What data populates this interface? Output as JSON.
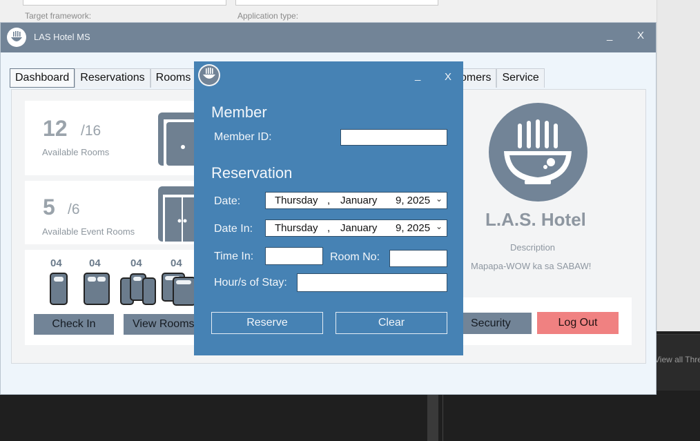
{
  "background": {
    "target_framework_label": "Target framework:",
    "application_type_label": "Application type:",
    "view_all_text": "View all Thre"
  },
  "window": {
    "title": "LAS Hotel MS",
    "minimize": "_",
    "close": "X"
  },
  "tabs": [
    "Dashboard",
    "Reservations",
    "Rooms",
    "omers",
    "Service"
  ],
  "dashboard": {
    "rooms": {
      "available": "12",
      "total": "/16",
      "label": "Available Rooms"
    },
    "event_rooms": {
      "available": "5",
      "total": "/6",
      "label": "Available Event Rooms"
    },
    "room_types": [
      {
        "count": "04",
        "icon": "single-bed-icon"
      },
      {
        "count": "04",
        "icon": "double-bed-icon"
      },
      {
        "count": "04",
        "icon": "triple-bed-icon"
      },
      {
        "count": "04",
        "icon": "family-bed-icon"
      }
    ],
    "check_in_label": "Check In",
    "view_rooms_label": "View Rooms",
    "security_label": "Security",
    "logout_label": "Log Out"
  },
  "hotel": {
    "name": "L.A.S. Hotel",
    "description_label": "Description",
    "description": "Mapapa-WOW ka sa SABAW!"
  },
  "modal": {
    "minimize": "_",
    "close": "X",
    "member_heading": "Member",
    "member_id_label": "Member ID:",
    "member_id_value": "",
    "reservation_heading": "Reservation",
    "date_label": "Date:",
    "date_value": {
      "weekday": "Thursday",
      "sep": ",",
      "month": "January",
      "day": "9, 2025"
    },
    "date_in_label": "Date In:",
    "date_in_value": {
      "weekday": "Thursday",
      "sep": ",",
      "month": "January",
      "day": "9, 2025"
    },
    "time_in_label": "Time In:",
    "time_in_value": "",
    "room_no_label": "Room No:",
    "room_no_value": "",
    "hours_label": "Hour/s of Stay:",
    "hours_value": "",
    "reserve_label": "Reserve",
    "clear_label": "Clear"
  },
  "colors": {
    "titlebar": "#728497",
    "modal": "#4682b4",
    "danger": "#f08181"
  }
}
